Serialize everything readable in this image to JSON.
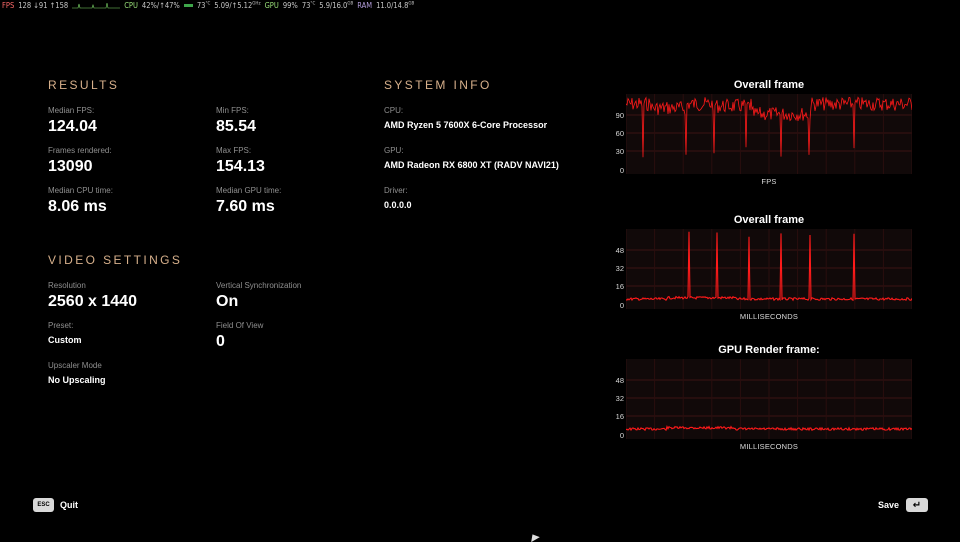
{
  "overlay": {
    "fps_label": "FPS",
    "fps_values": "128 ↓91 ↑158",
    "cpu_label": "CPU",
    "cpu_values": "42%/↑47%",
    "cpu_temp": "73",
    "temp_unit": "°C",
    "cpu_clock": "5.09/↑5.12",
    "clock_unit": "GHz",
    "gpu_label": "GPU",
    "gpu_values": "99%",
    "gpu_temp": "73",
    "gpu_mem": "5.9/16.0",
    "mem_unit": "GB",
    "ram_label": "RAM",
    "ram_values": "11.0/14.8",
    "colors": {
      "fps": "#ff6a6a",
      "cpu": "#9be27a",
      "ram": "#b39ddb"
    }
  },
  "results": {
    "heading": "RESULTS",
    "median_fps": {
      "label": "Median FPS:",
      "value": "124.04"
    },
    "min_fps": {
      "label": "Min FPS:",
      "value": "85.54"
    },
    "frames_rendered": {
      "label": "Frames rendered:",
      "value": "13090"
    },
    "max_fps": {
      "label": "Max FPS:",
      "value": "154.13"
    },
    "median_cpu": {
      "label": "Median CPU time:",
      "value": "8.06 ms"
    },
    "median_gpu": {
      "label": "Median GPU time:",
      "value": "7.60 ms"
    }
  },
  "video_settings": {
    "heading": "VIDEO SETTINGS",
    "resolution": {
      "label": "Resolution",
      "value": "2560 x 1440"
    },
    "vsync": {
      "label": "Vertical Synchronization",
      "value": "On"
    },
    "preset": {
      "label": "Preset:",
      "value": "Custom"
    },
    "fov": {
      "label": "Field Of View",
      "value": "0"
    },
    "upscaler": {
      "label": "Upscaler Mode",
      "value": "No Upscaling"
    }
  },
  "system_info": {
    "heading": "SYSTEM INFO",
    "cpu": {
      "label": "CPU:",
      "value": "AMD Ryzen 5 7600X 6-Core Processor"
    },
    "gpu": {
      "label": "GPU:",
      "value": "AMD Radeon RX 6800 XT (RADV NAVI21)"
    },
    "driver": {
      "label": "Driver:",
      "value": "0.0.0.0"
    }
  },
  "chart_data": [
    {
      "type": "line",
      "title": "Overall frame",
      "xlabel": "FPS",
      "yticks": [
        "90",
        "60",
        "30",
        "0"
      ],
      "color": "#ff1a1a"
    },
    {
      "type": "line",
      "title": "Overall frame",
      "xlabel": "MILLISECONDS",
      "yticks": [
        "48",
        "32",
        "16",
        "0"
      ],
      "color": "#ff1a1a"
    },
    {
      "type": "line",
      "title": "GPU Render frame:",
      "xlabel": "MILLISECONDS",
      "yticks": [
        "48",
        "32",
        "16",
        "0"
      ],
      "color": "#ff1a1a"
    }
  ],
  "footer": {
    "quit_key": "ESC",
    "quit_label": "Quit",
    "save_label": "Save",
    "save_key": "↵"
  }
}
